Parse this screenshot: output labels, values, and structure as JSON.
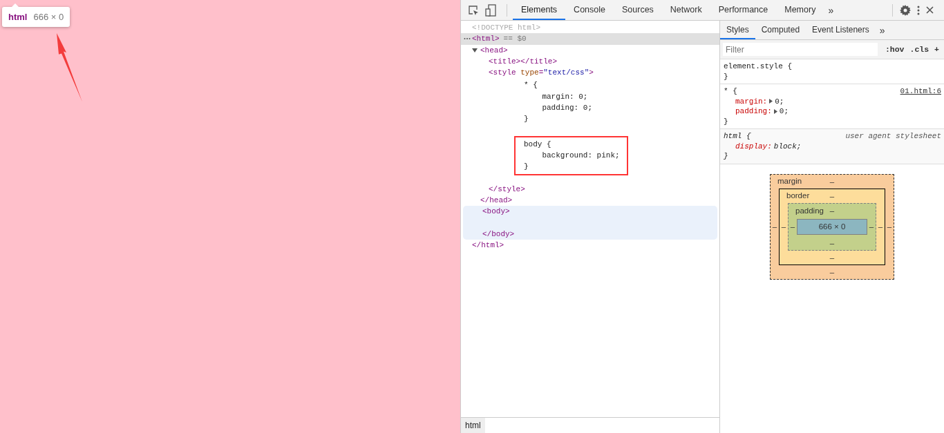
{
  "page": {
    "tooltip": {
      "tag": "html",
      "size": "666 × 0"
    }
  },
  "toolbar": {
    "tabs": [
      {
        "label": "Elements",
        "selected": true
      },
      {
        "label": "Console",
        "selected": false
      },
      {
        "label": "Sources",
        "selected": false
      },
      {
        "label": "Network",
        "selected": false
      },
      {
        "label": "Performance",
        "selected": false
      },
      {
        "label": "Memory",
        "selected": false
      }
    ],
    "overflow": "»"
  },
  "dom": [
    {
      "text": "<!DOCTYPE html>",
      "kind": "doctype"
    },
    {
      "text": "<html>",
      "marker": "== $0",
      "selected": true,
      "close": "</html>",
      "children": [
        {
          "text": "<head>",
          "expanded": true,
          "close": "</head>",
          "children": [
            {
              "text": "<title></title>"
            },
            {
              "parts": [
                {
                  "text": "<style ",
                  "kind": "tag"
                },
                {
                  "text": "type",
                  "kind": "attr"
                },
                {
                  "text": "=",
                  "kind": "tag"
                },
                {
                  "text": "\"text/css\"",
                  "kind": "value"
                },
                {
                  "text": ">",
                  "kind": "tag"
                }
              ],
              "close": "</style>",
              "children": [
                {
                  "kind": "css",
                  "boxed": false,
                  "lines": [
                    "* {",
                    "    margin: 0;",
                    "    padding: 0;",
                    "}"
                  ]
                },
                {
                  "kind": "css",
                  "boxed": true,
                  "lines": [
                    "body {",
                    "    background: pink;",
                    "}"
                  ]
                }
              ]
            }
          ]
        },
        {
          "text": "<body>",
          "hovered": true,
          "close": "</body>"
        }
      ]
    }
  ],
  "styles": {
    "tabs": [
      {
        "label": "Styles",
        "selected": true
      },
      {
        "label": "Computed",
        "selected": false
      },
      {
        "label": "Event Listeners",
        "selected": false
      }
    ],
    "overflow": "»",
    "filter": {
      "placeholder": "Filter"
    },
    "buttons": [
      ":hov",
      ".cls",
      "+"
    ],
    "rules": [
      {
        "selector": "element.style {",
        "close": "}",
        "kind": "inline"
      },
      {
        "selector": "* {",
        "source": "01.html:6",
        "close": "}",
        "kind": "author",
        "props": [
          {
            "name": "margin:",
            "value": "0;",
            "expandable": true
          },
          {
            "name": "padding:",
            "value": "0;",
            "expandable": true
          }
        ]
      },
      {
        "selector": "html {",
        "source": "user agent stylesheet",
        "close": "}",
        "kind": "user-agent",
        "props": [
          {
            "name": "display:",
            "value": "block;",
            "expandable": false
          }
        ]
      }
    ],
    "box_model": {
      "margin": {
        "label": "margin",
        "top": "–",
        "right": "–",
        "bottom": "–",
        "left": "–"
      },
      "border": {
        "label": "border",
        "top": "–",
        "right": "–",
        "bottom": "–",
        "left": "–"
      },
      "padding": {
        "label": "padding",
        "top": "–",
        "right": "–",
        "bottom": "–",
        "left": "–"
      },
      "content": "666 × 0"
    }
  },
  "breadcrumb": [
    {
      "label": "html",
      "selected": true
    }
  ]
}
